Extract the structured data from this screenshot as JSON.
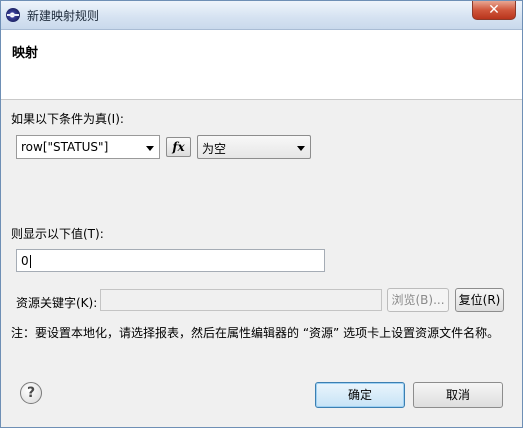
{
  "window": {
    "title": "新建映射规则",
    "close_glyph": "✕",
    "app_icon": "eclipse-icon",
    "help_icon": "help-icon"
  },
  "header": {
    "title": "映射"
  },
  "condition": {
    "label": "如果以下条件为真(I):",
    "expression_value": "row[\"STATUS\"]",
    "fx_label": "fx",
    "operator_value": "为空"
  },
  "display": {
    "label": "则显示以下值(T):",
    "value": "0"
  },
  "resource": {
    "label": "资源关键字(K):",
    "value": "",
    "browse_label": "浏览(B)...",
    "reset_label": "复位(R)"
  },
  "note": "注：要设置本地化，请选择报表，然后在属性编辑器的 “资源” 选项卡上设置资源文件名称。",
  "footer": {
    "ok_label": "确定",
    "cancel_label": "取消",
    "help_glyph": "?"
  }
}
